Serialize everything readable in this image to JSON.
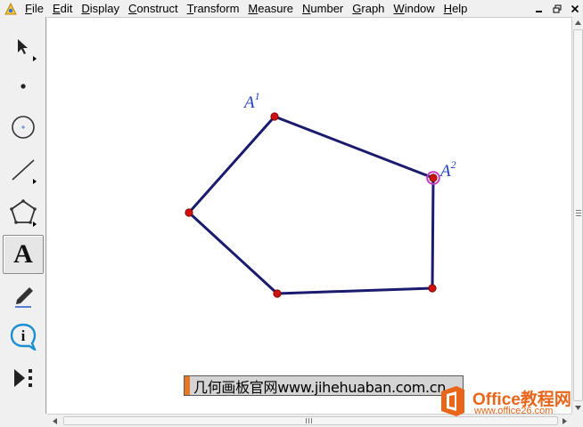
{
  "menubar": {
    "items": [
      {
        "accel": "F",
        "rest": "ile"
      },
      {
        "accel": "E",
        "rest": "dit"
      },
      {
        "accel": "D",
        "rest": "isplay"
      },
      {
        "accel": "C",
        "rest": "onstruct"
      },
      {
        "accel": "T",
        "rest": "ransform"
      },
      {
        "accel": "M",
        "rest": "easure"
      },
      {
        "accel": "N",
        "rest": "umber"
      },
      {
        "accel": "G",
        "rest": "raph"
      },
      {
        "accel": "W",
        "rest": "indow"
      },
      {
        "accel": "H",
        "rest": "elp"
      }
    ]
  },
  "window_controls": {
    "minimize_icon": "minimize-icon",
    "restore_icon": "restore-icon",
    "close_icon": "close-icon"
  },
  "toolbox": {
    "tools": [
      {
        "id": "arrow",
        "icon": "selection-arrow-icon",
        "has_submenu": true
      },
      {
        "id": "point",
        "icon": "point-tool-icon",
        "has_submenu": false
      },
      {
        "id": "compass",
        "icon": "compass-tool-icon",
        "has_submenu": false
      },
      {
        "id": "line",
        "icon": "straightedge-tool-icon",
        "has_submenu": true
      },
      {
        "id": "polygon",
        "icon": "polygon-tool-icon",
        "has_submenu": true
      },
      {
        "id": "text",
        "icon": "text-tool-icon",
        "label": "A",
        "active": true
      },
      {
        "id": "marker",
        "icon": "marker-tool-icon",
        "has_submenu": false
      },
      {
        "id": "info",
        "icon": "information-tool-icon",
        "label": "i",
        "has_submenu": false
      },
      {
        "id": "custom",
        "icon": "custom-tool-icon",
        "has_submenu": false
      }
    ]
  },
  "sketch": {
    "line_color": "#1a1a6e",
    "point_color": "#cc1111",
    "selected_ring_color": "#c040c0",
    "label_color": "#1f3fbf",
    "labels": [
      {
        "base": "A",
        "sup": "1"
      },
      {
        "base": "A",
        "sup": "2"
      }
    ]
  },
  "banner": {
    "text": "几何画板官网www.jihehuaban.com.cn",
    "accent_color": "#e87722"
  },
  "logo": {
    "title": "Office教程网",
    "url": "www.office26.com",
    "color": "#e8651a"
  }
}
